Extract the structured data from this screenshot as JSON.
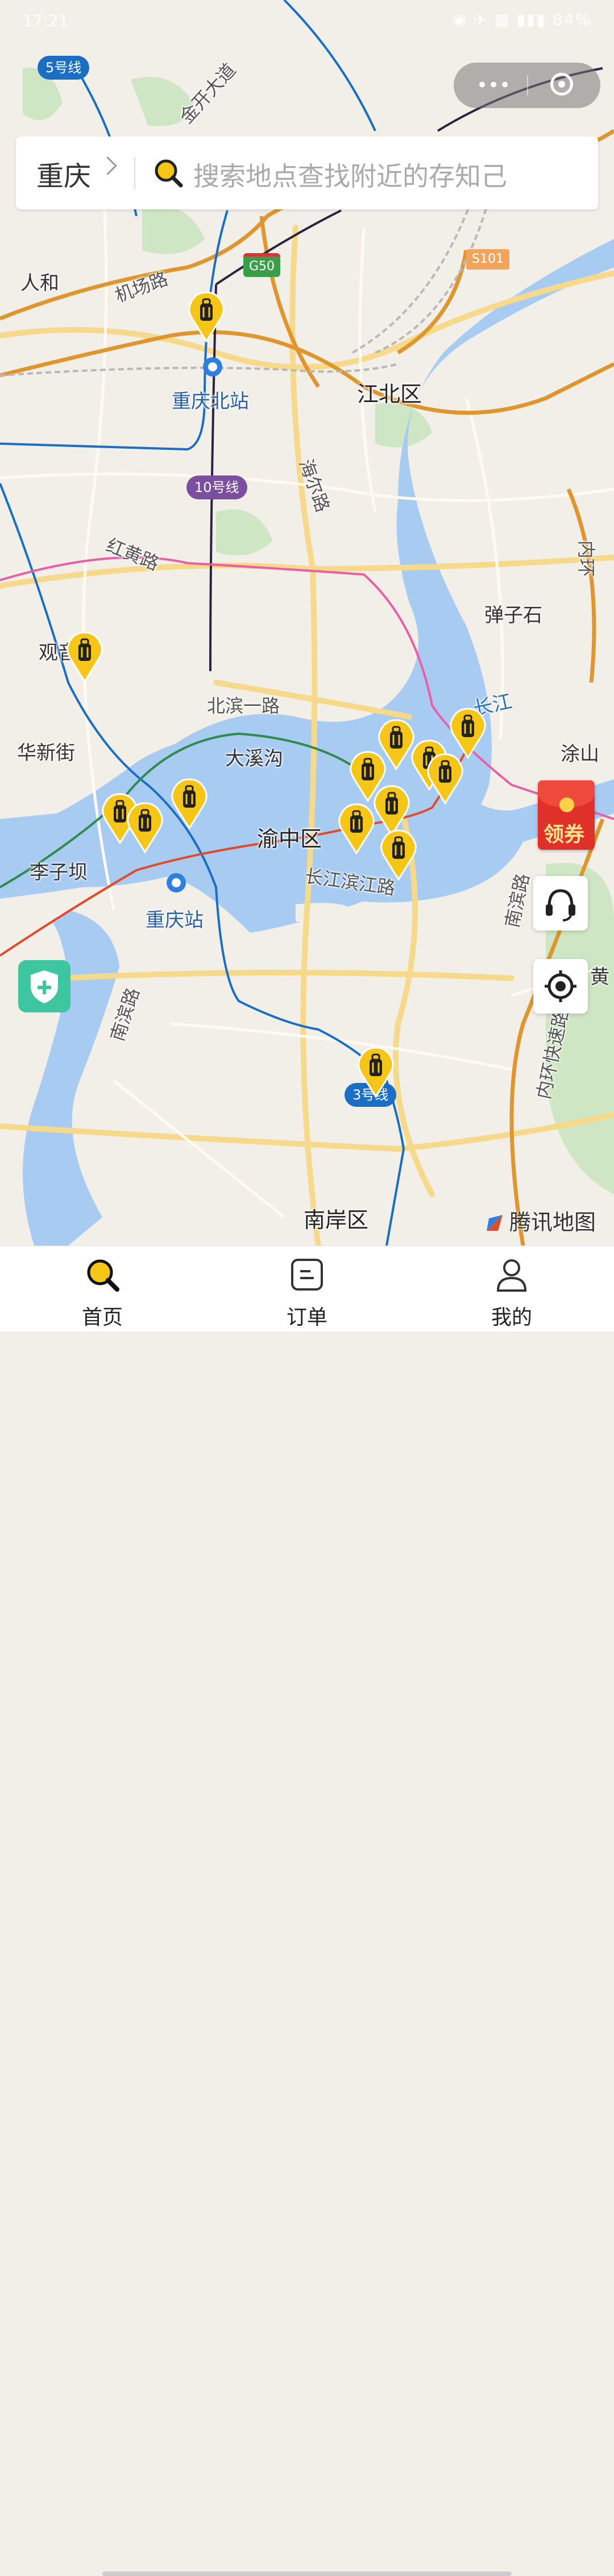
{
  "status_bar": {
    "time": "17:21",
    "icons": "◉ ✈ ▦ ▮▮▮ 84%"
  },
  "header": {
    "city": "重庆",
    "search_placeholder": "搜索地点查找附近的存知己"
  },
  "map": {
    "labels": {
      "jinkai": "金开大道",
      "jichang": "机场路",
      "renhe": "人和",
      "chongqingbei": "重庆北站",
      "jiangbei": "江北区",
      "haier": "海尔路",
      "honghuang": "红黄路",
      "danzishi": "弹子石",
      "huaxin": "华新街",
      "beibin": "北滨一路",
      "daxigou": "大溪沟",
      "yuzhong": "渝中区",
      "changjiangbinjiang": "长江滨江路",
      "liziba": "李子坝",
      "chongqingzhan": "重庆站",
      "changjiang": "长江",
      "tushan": "涂山",
      "nanbin": "南滨路",
      "nanbin2": "南滨路",
      "neihuan": "内环快速路",
      "nanan": "南岸区",
      "huang": "黄",
      "nei": "内环",
      "guanyin": "观音桥"
    },
    "metro_badges": {
      "line5": "5号线",
      "line10": "10号线",
      "line3": "3号线"
    },
    "road_shields": {
      "g50": "G50",
      "s101": "S101"
    },
    "provider": "腾讯地图",
    "pin_count": 16
  },
  "coupon": {
    "label": "领券"
  },
  "tabs": [
    {
      "label": "首页",
      "icon": "search-icon",
      "active": true
    },
    {
      "label": "订单",
      "icon": "order-icon",
      "active": false
    },
    {
      "label": "我的",
      "icon": "user-icon",
      "active": false
    }
  ],
  "colors": {
    "accent": "#f5c518",
    "pin": "#f5c518",
    "water": "#a8cbf2",
    "metro_blue": "#1a6fc4",
    "coupon": "#e0302a"
  }
}
